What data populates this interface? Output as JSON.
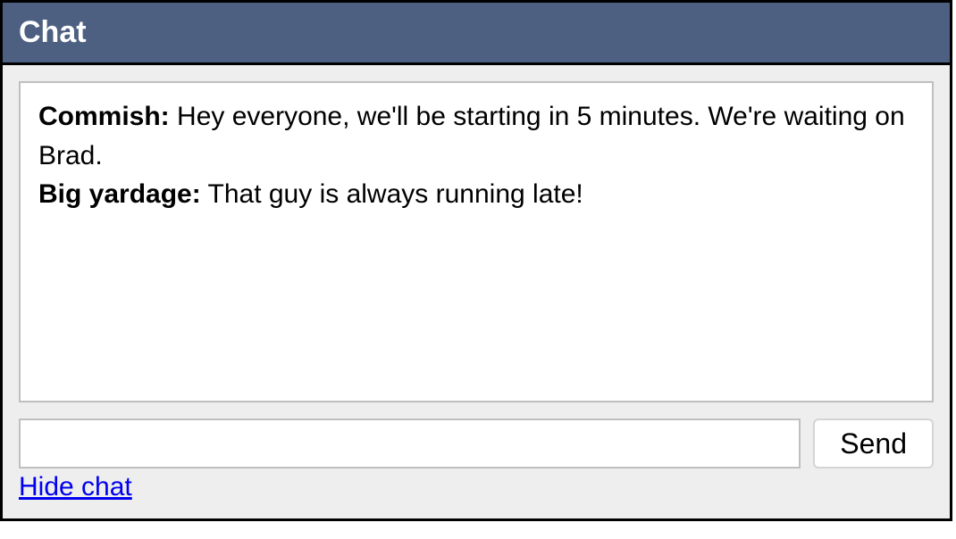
{
  "header": {
    "title": "Chat"
  },
  "messages": [
    {
      "author": "Commish:",
      "text": " Hey everyone, we'll be starting in 5 minutes. We're waiting on Brad."
    },
    {
      "author": "Big yardage:",
      "text": " That guy is always running late!"
    }
  ],
  "input": {
    "value": "",
    "placeholder": ""
  },
  "buttons": {
    "send": "Send"
  },
  "links": {
    "hide_chat": "Hide chat"
  }
}
